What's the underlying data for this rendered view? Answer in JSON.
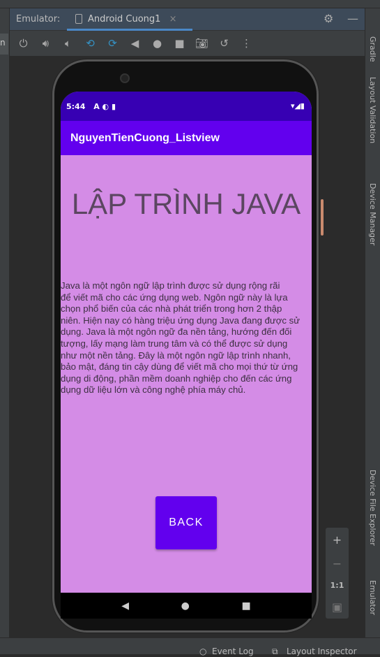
{
  "ide": {
    "emulator_label": "Emulator:",
    "device_tab": "Android Cuong1",
    "close_glyph": "×",
    "left_tab_text": "n",
    "right_tools": [
      "Gradle",
      "Layout Validation",
      "Device Manager",
      "Device File Explorer",
      "Emulator"
    ],
    "toolbar_icons": [
      "power-icon",
      "volume-up-icon",
      "volume-down-icon",
      "rotate-left-icon",
      "rotate-right-icon",
      "back-icon",
      "home-icon",
      "overview-icon",
      "camera-icon",
      "snapshot-icon",
      "more-icon"
    ],
    "zoom": {
      "plus": "+",
      "minus": "−",
      "one_to_one": "1:1"
    },
    "status_bar": [
      "Event Log",
      "Layout Inspector"
    ]
  },
  "device": {
    "time": "5:44",
    "status_icons": "A ◐ ▮",
    "status_right": "▾◢▮",
    "app_title": "NguyenTienCuong_Listview",
    "heading": "LẬP TRÌNH JAVA",
    "paragraph_lines": [
      "Java là một ngôn ngữ lập trình được sử dụng rộng rãi",
      "để viết mã cho các ứng dụng web. Ngôn ngữ này là lựa",
      "chọn phổ biến của các nhà phát triển trong hơn 2 thập",
      "niên. Hiện nay có hàng triệu ứng dụng Java đang được sử",
      "dụng. Java là một ngôn ngữ đa nền tảng, hướng đến đối",
      "tượng, lấy mạng làm trung tâm và có thể được sử dụng",
      "như một nền tảng. Đây là một ngôn ngữ lập trình nhanh,",
      "bảo mật, đáng tin cậy dùng để viết mã cho mọi thứ từ ứng",
      "dụng di động, phần mềm doanh nghiệp cho đến các ứng",
      "dụng dữ liệu lớn và công nghệ phía máy chủ."
    ],
    "back_button": "BACK",
    "colors": {
      "primary": "#6200ee",
      "primary_dark": "#3700b3",
      "background": "#d48ce6"
    }
  }
}
